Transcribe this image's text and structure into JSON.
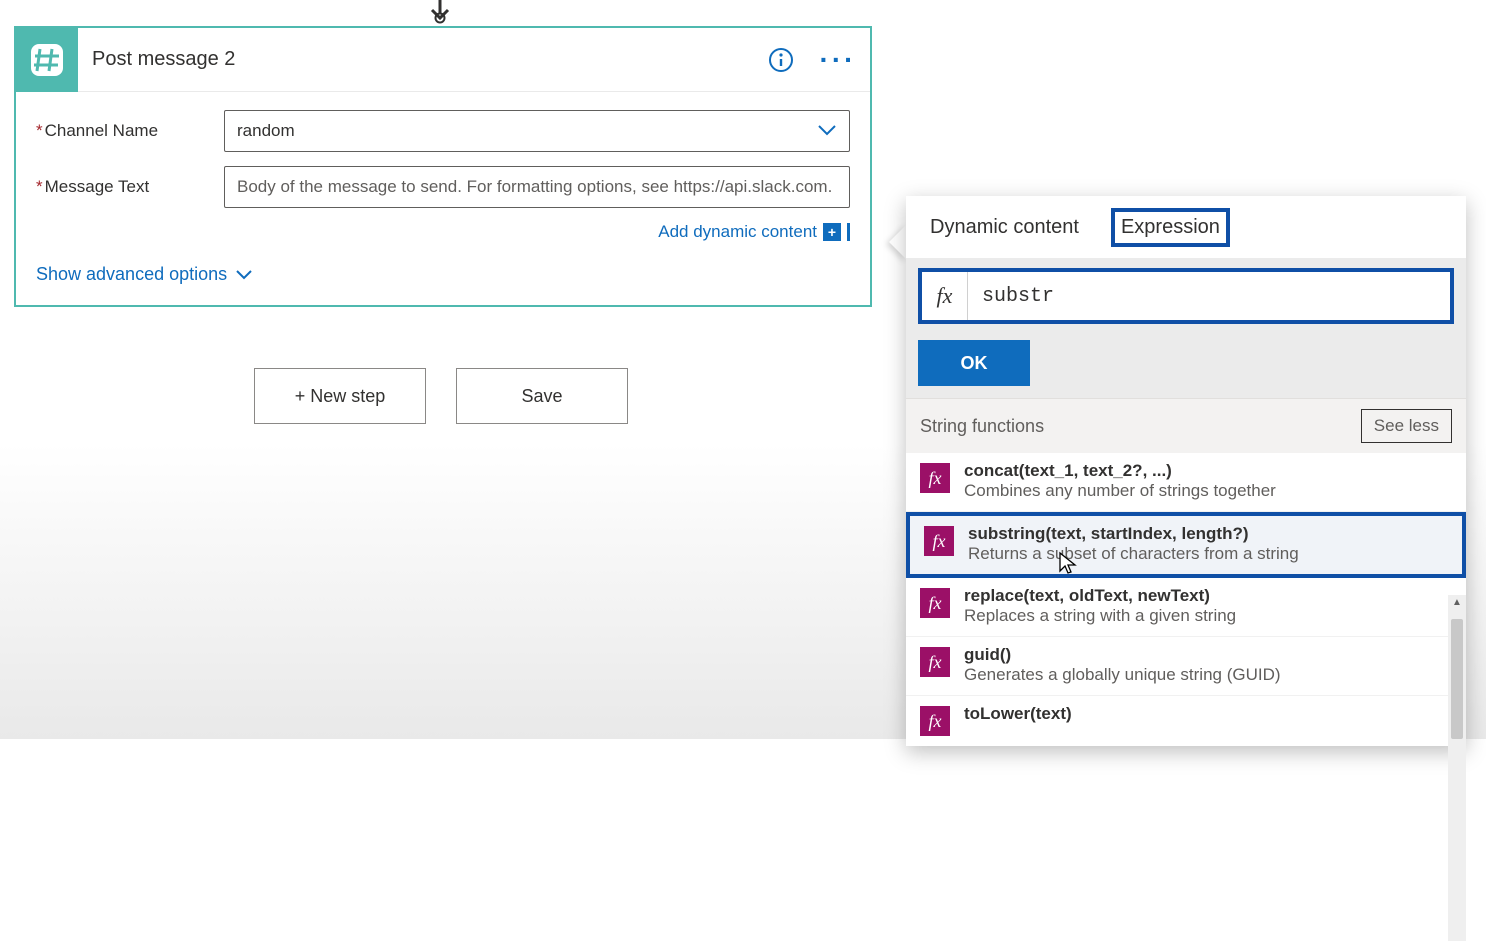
{
  "action": {
    "title": "Post message 2",
    "icon": "hash-icon",
    "fields": [
      {
        "label": "Channel Name",
        "required": true,
        "value": "random",
        "type": "select"
      },
      {
        "label": "Message Text",
        "required": true,
        "placeholder": "Body of the message to send. For formatting options, see https://api.slack.com.",
        "type": "text"
      }
    ],
    "add_dynamic_label": "Add dynamic content",
    "advanced_toggle": "Show advanced options"
  },
  "buttons": {
    "new_step": "+ New step",
    "save": "Save"
  },
  "flyout": {
    "tabs": {
      "dynamic": "Dynamic content",
      "expression": "Expression"
    },
    "active_tab": "expression",
    "expression_value": "substr",
    "ok_label": "OK",
    "section_title": "String functions",
    "see_less": "See less",
    "items": [
      {
        "name": "concat(text_1, text_2?, ...)",
        "desc": "Combines any number of strings together",
        "highlight": false
      },
      {
        "name": "substring(text, startIndex, length?)",
        "desc": "Returns a subset of characters from a string",
        "highlight": true
      },
      {
        "name": "replace(text, oldText, newText)",
        "desc": "Replaces a string with a given string",
        "highlight": false
      },
      {
        "name": "guid()",
        "desc": "Generates a globally unique string (GUID)",
        "highlight": false
      },
      {
        "name": "toLower(text)",
        "desc": "",
        "highlight": false
      }
    ],
    "fx_symbol": "fx"
  }
}
